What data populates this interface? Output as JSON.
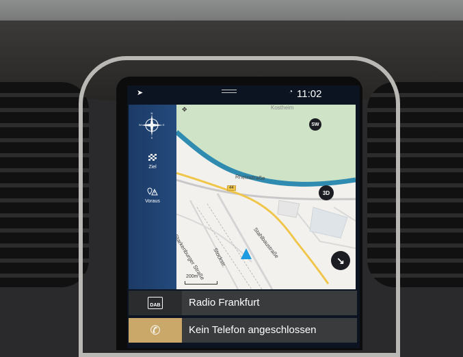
{
  "status": {
    "time": "11:02"
  },
  "sidebar": {
    "compass": {
      "n": "N",
      "e": "E",
      "s": "S",
      "w": "W"
    },
    "items": [
      {
        "label": "Ziel",
        "icon": "checkered-flag-icon"
      },
      {
        "label": "Voraus",
        "icon": "location-warning-icon"
      }
    ]
  },
  "map": {
    "streets": {
      "rheinstrasse": "Rheinstraße",
      "starkenburger": "Starkenburger Straße",
      "stahlbaustrasse": "Stahlbaustraße",
      "stockstrasse": "Stockstr."
    },
    "road_number": "44",
    "corner_label": "Kostheim",
    "compass_button": "SW",
    "view_button": "3D",
    "scale": "200m"
  },
  "tiles": {
    "radio": {
      "icon_label": "DAB",
      "label": "Radio Frankfurt"
    },
    "phone": {
      "label": "Kein Telefon angeschlossen"
    }
  },
  "colors": {
    "river": "#2f8cb0",
    "water_green": "#cfe3c6",
    "road_yellow": "#f0c64a",
    "sidebar_blue": "#1f4272",
    "phone_accent": "#c9a86a",
    "marker_blue": "#1e9be0"
  }
}
